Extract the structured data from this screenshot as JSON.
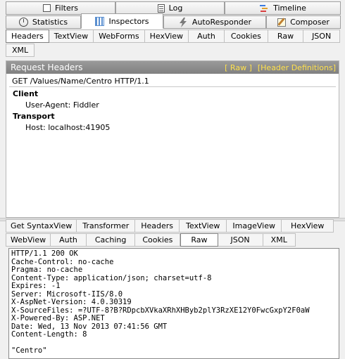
{
  "top_tabs_row1": [
    {
      "label": "Filters",
      "icon": "filter-icon"
    },
    {
      "label": "Log",
      "icon": "log-icon"
    },
    {
      "label": "Timeline",
      "icon": "timeline-icon"
    }
  ],
  "top_tabs_row2": [
    {
      "label": "Statistics",
      "icon": "statistics-icon"
    },
    {
      "label": "Inspectors",
      "icon": "inspectors-icon",
      "active": true
    },
    {
      "label": "AutoResponder",
      "icon": "lightning-icon"
    },
    {
      "label": "Composer",
      "icon": "composer-icon"
    }
  ],
  "request_tabs": [
    "Headers",
    "TextView",
    "WebForms",
    "HexView",
    "Auth",
    "Cookies",
    "Raw",
    "JSON"
  ],
  "request_tabs_row2": [
    "XML"
  ],
  "request_selected_tab": "Headers",
  "request_panel": {
    "title": "Request Headers",
    "link_raw": "[ Raw ]",
    "link_defs": "[Header Definitions]",
    "request_line": "GET /Values/Name/Centro HTTP/1.1",
    "groups": [
      {
        "name": "Client",
        "headers": [
          "User-Agent: Fiddler"
        ]
      },
      {
        "name": "Transport",
        "headers": [
          "Host: localhost:41905"
        ]
      }
    ]
  },
  "response_tabs_row1": [
    "Get SyntaxView",
    "Transformer",
    "Headers",
    "TextView",
    "ImageView",
    "HexView"
  ],
  "response_tabs_row2": [
    "WebView",
    "Auth",
    "Caching",
    "Cookies",
    "Raw",
    "JSON",
    "XML"
  ],
  "response_selected_tab": "Raw",
  "response_raw": [
    "HTTP/1.1 200 OK",
    "Cache-Control: no-cache",
    "Pragma: no-cache",
    "Content-Type: application/json; charset=utf-8",
    "Expires: -1",
    "Server: Microsoft-IIS/8.0",
    "X-AspNet-Version: 4.0.30319",
    "X-SourceFiles: =?UTF-8?B?RDpcbXVkaXRhXHByb2plY3RzXE12Y0FwcGxpY2F0aW",
    "X-Powered-By: ASP.NET",
    "Date: Wed, 13 Nov 2013 07:41:56 GMT",
    "Content-Length: 8",
    "",
    "\"Centro\""
  ],
  "colors": {
    "header_bar": "#8c8c8c",
    "header_link": "#ffe14d",
    "background": "#f0f0f0"
  }
}
